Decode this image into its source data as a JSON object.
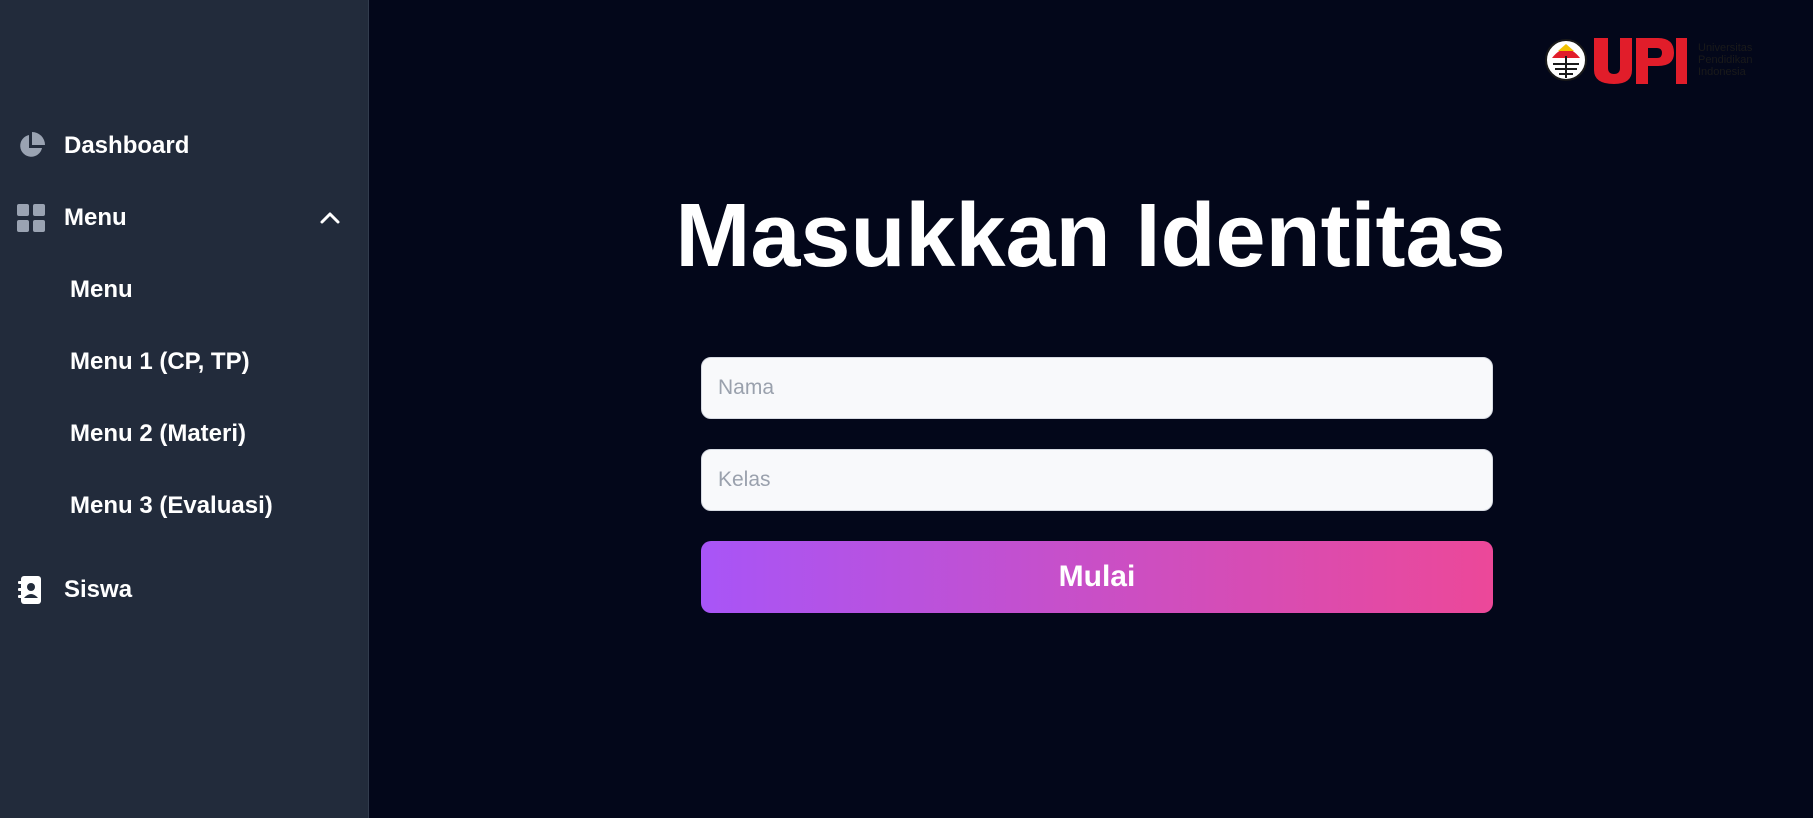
{
  "sidebar": {
    "dashboard_label": "Dashboard",
    "menu_label": "Menu",
    "submenu": [
      {
        "label": "Menu"
      },
      {
        "label": "Menu 1 (CP, TP)"
      },
      {
        "label": "Menu 2 (Materi)"
      },
      {
        "label": "Menu 3 (Evaluasi)"
      }
    ],
    "siswa_label": "Siswa",
    "icons": {
      "dashboard": "pie-chart-icon",
      "menu": "grid-icon",
      "menu_toggle": "chevron-up-icon",
      "siswa": "contact-book-icon"
    }
  },
  "header": {
    "logo_text": "UPI",
    "logo_subtitle": [
      "Universitas",
      "Pendidikan",
      "Indonesia"
    ]
  },
  "main": {
    "title": "Masukkan Identitas",
    "name_field": {
      "placeholder": "Nama",
      "value": ""
    },
    "class_field": {
      "placeholder": "Kelas",
      "value": ""
    },
    "start_button_label": "Mulai"
  },
  "colors": {
    "sidebar_bg": "#222b3b",
    "main_bg": "#03071a",
    "button_gradient_start": "#a855f7",
    "button_gradient_end": "#ec4899",
    "logo_red": "#e11d2a"
  }
}
